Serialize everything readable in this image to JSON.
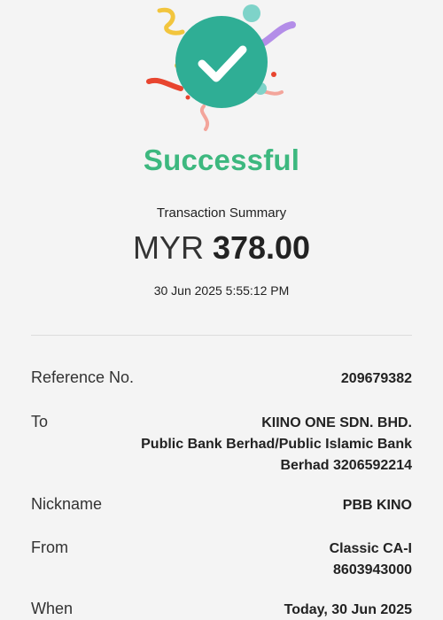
{
  "status": {
    "title": "Successful",
    "summary_label": "Transaction Summary",
    "currency": "MYR",
    "amount": "378.00",
    "datetime": "30 Jun 2025 5:55:12 PM"
  },
  "details": {
    "reference": {
      "label": "Reference No.",
      "value": "209679382"
    },
    "to": {
      "label": "To",
      "lines": [
        "KIINO ONE SDN. BHD.",
        "Public Bank Berhad/Public Islamic Bank",
        "Berhad 3206592214"
      ]
    },
    "nickname": {
      "label": "Nickname",
      "value": "PBB KINO"
    },
    "from": {
      "label": "From",
      "lines": [
        "Classic  CA-I",
        "8603943000"
      ]
    },
    "when": {
      "label": "When",
      "value": "Today, 30 Jun 2025"
    }
  },
  "colors": {
    "success_green": "#3db87f",
    "badge_teal": "#2fae95",
    "background": "#f4f4f4"
  },
  "icons": {
    "success_badge": "checkmark-icon"
  }
}
